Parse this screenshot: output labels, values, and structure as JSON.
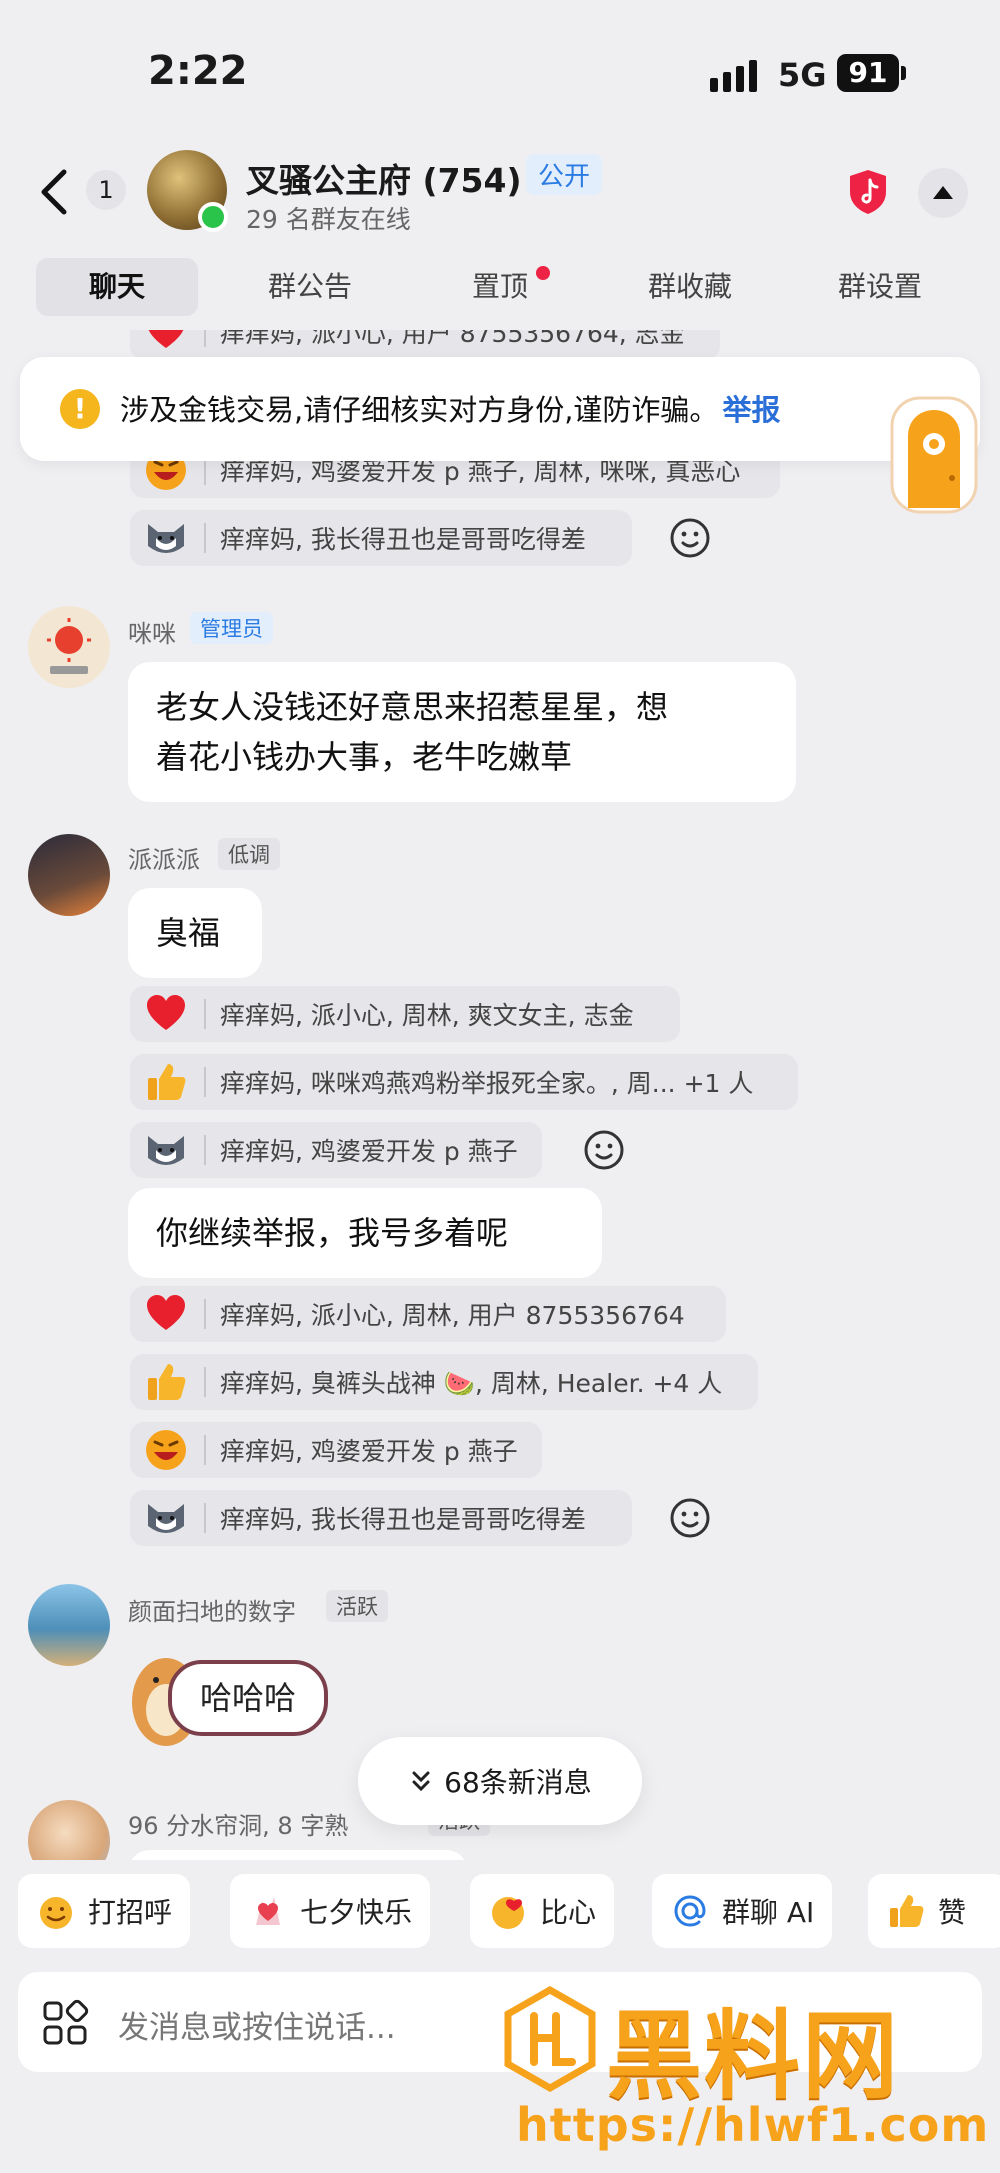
{
  "status_bar": {
    "time": "2:22",
    "network": "5G",
    "battery": "91"
  },
  "header": {
    "unread_count": "1",
    "group_name": "叉骚公主府 (754)",
    "public_badge": "公开",
    "online_text": "29 名群友在线"
  },
  "tabs": [
    {
      "label": "聊天",
      "active": true
    },
    {
      "label": "群公告"
    },
    {
      "label": "置顶",
      "has_dot": true
    },
    {
      "label": "群收藏"
    },
    {
      "label": "群设置"
    }
  ],
  "warning": {
    "text": "涉及金钱交易,请仔细核实对方身份,谨防诈骗。",
    "link": "举报"
  },
  "top_reactions": [
    {
      "icon": "heart",
      "text": "痒痒妈, 派小心, 用户 8755356764, 志金"
    },
    {
      "icon": "laugh",
      "text": "痒痒妈, 鸡婆爱开发 p 燕子, 周林, 咪咪, 真恶心"
    },
    {
      "icon": "dog",
      "text": "痒痒妈, 我长得丑也是哥哥吃得差"
    }
  ],
  "messages": [
    {
      "sender": "咪咪",
      "tag": "管理员",
      "text_lines": [
        "老女人没钱还好意思来招惹星星，想",
        "着花小钱办大事，老牛吃嫩草"
      ]
    },
    {
      "sender": "派派派",
      "tag": "低调",
      "text": "臭福",
      "reactions": [
        {
          "icon": "heart",
          "text": "痒痒妈, 派小心, 周林, 爽文女主, 志金"
        },
        {
          "icon": "thumb",
          "text": "痒痒妈, 咪咪鸡燕鸡粉举报死全家。, 周... +1 人"
        },
        {
          "icon": "dog",
          "text": "痒痒妈, 鸡婆爱开发 p 燕子"
        }
      ],
      "text2": "你继续举报，我号多着呢",
      "reactions2": [
        {
          "icon": "heart",
          "text": "痒痒妈, 派小心, 周林, 用户 8755356764"
        },
        {
          "icon": "thumb",
          "text": "痒痒妈, 臭裤头战神 🍉, 周林, Healer. +4 人"
        },
        {
          "icon": "laugh",
          "text": "痒痒妈, 鸡婆爱开发 p 燕子"
        },
        {
          "icon": "dog",
          "text": "痒痒妈, 我长得丑也是哥哥吃得差"
        }
      ]
    },
    {
      "sender": "颜面扫地的数字",
      "tag": "活跃",
      "sticker_text": "哈哈哈"
    },
    {
      "sender": "96 分水帘洞, 8 字熟",
      "tag": "活跃"
    }
  ],
  "new_messages": "68条新消息",
  "quick_replies": [
    {
      "icon": "wave-emoji",
      "label": "打招呼"
    },
    {
      "icon": "qixi-emoji",
      "label": "七夕快乐"
    },
    {
      "icon": "heart-hands-emoji",
      "label": "比心"
    },
    {
      "icon": "at-icon",
      "label": "群聊 AI"
    },
    {
      "icon": "thumb-emoji",
      "label": "赞"
    }
  ],
  "input": {
    "placeholder": "发消息或按住说话..."
  },
  "watermark": {
    "title": "黑料网",
    "url": "https://hlwf1.com"
  },
  "colors": {
    "accent_blue": "#2a7be2",
    "warning_yellow": "#f5b51c",
    "watermark_orange": "#f7a21b",
    "badge_red": "#ee2244"
  }
}
